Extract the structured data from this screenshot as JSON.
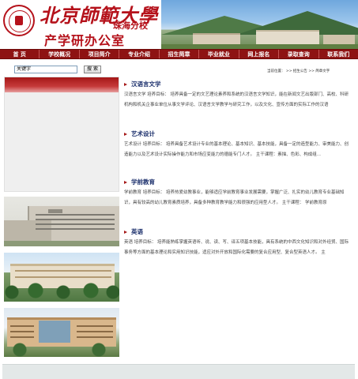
{
  "header": {
    "university_name": "北京師範大學",
    "campus": "珠海分校",
    "office_name": "产学研办公室"
  },
  "nav": {
    "items": [
      "首 页",
      "学校概况",
      "项目简介",
      "专业介绍",
      "招生简章",
      "毕业就业",
      "网上报名",
      "录取查询",
      "联系我们"
    ]
  },
  "search": {
    "value": "关键字",
    "button_label": "搜 索"
  },
  "status_line": "当前位置： >> 招生公告 >> 简章文字",
  "programs": [
    {
      "title": "汉语言文学",
      "description": "汉语言文学 培养目标： 培养具备一定的文艺理论素养和系统的汉语言文学知识，能在新闻文艺出版部门、高校、科研机构和机关企事业单位从事文学评论、汉语言文学教学与研究工作，以及文化、宣传方面的实际工作的汉语"
    },
    {
      "title": "艺术设计",
      "description": "艺术设计 培养目标： 培养具备艺术设计专业的基本理论、基本知识、基本技能，具备一定的造型能力、审美能力、创造能力以及艺术设计实际操作能力和市场应变能力的德能专门人才。 主干课程：素描、色彩、构成组..."
    },
    {
      "title": "学前教育",
      "description": "学前教育 培养目标： 培养热爱幼教事业，能够适应学前教育事业发展需要，掌握广泛、扎实的幼儿教育专业基础知识，具有较高的幼儿教育素质培养，具备多种教育教学能力和很强的应用型人才。 主干课程： 学前教育原"
    },
    {
      "title": "英语",
      "description": "英语 培养目标： 培养能熟练掌握英语听、说、读、写、译五项基本技能，具有系统的中西文化知识和对外经贸、国际事务等方面的基本理论和实用知识技能，适应对外开放和国际化需要的复合应用型、复合型英语人才。 主"
    }
  ],
  "colors": {
    "brand_red": "#b5121b",
    "nav_red": "#8e1313",
    "title_blue": "#1a2e6b",
    "footer_gray": "#e3e8e8"
  }
}
